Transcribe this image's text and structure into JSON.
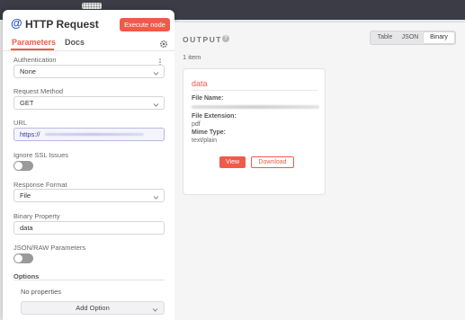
{
  "node": {
    "icon": "globe-at-icon",
    "title": "HTTP Request",
    "execute_label": "Execute node"
  },
  "tabs": {
    "parameters": "Parameters",
    "docs": "Docs"
  },
  "fields": {
    "authentication": {
      "label": "Authentication",
      "value": "None"
    },
    "request_method": {
      "label": "Request Method",
      "value": "GET"
    },
    "url": {
      "label": "URL",
      "value": "https://"
    },
    "ignore_ssl": {
      "label": "Ignore SSL Issues",
      "on": false
    },
    "response_format": {
      "label": "Response Format",
      "value": "File"
    },
    "binary_property": {
      "label": "Binary Property",
      "value": "data"
    },
    "json_raw": {
      "label": "JSON/RAW Parameters",
      "on": false
    }
  },
  "options": {
    "title": "Options",
    "empty_text": "No properties",
    "add_label": "Add Option"
  },
  "output": {
    "title": "OUTPUT",
    "views": [
      "Table",
      "JSON",
      "Binary"
    ],
    "active_view": "Binary",
    "item_count": "1 item",
    "binary": {
      "name": "data",
      "file_name_label": "File Name:",
      "file_ext_label": "File Extension:",
      "file_ext_value": "pdf",
      "mime_label": "Mime Type:",
      "mime_value": "text/plain",
      "view_label": "View",
      "download_label": "Download"
    }
  },
  "colors": {
    "accent": "#f05a4a",
    "backdrop": "#3c3c46",
    "panel_bg": "#f5f5f6"
  }
}
